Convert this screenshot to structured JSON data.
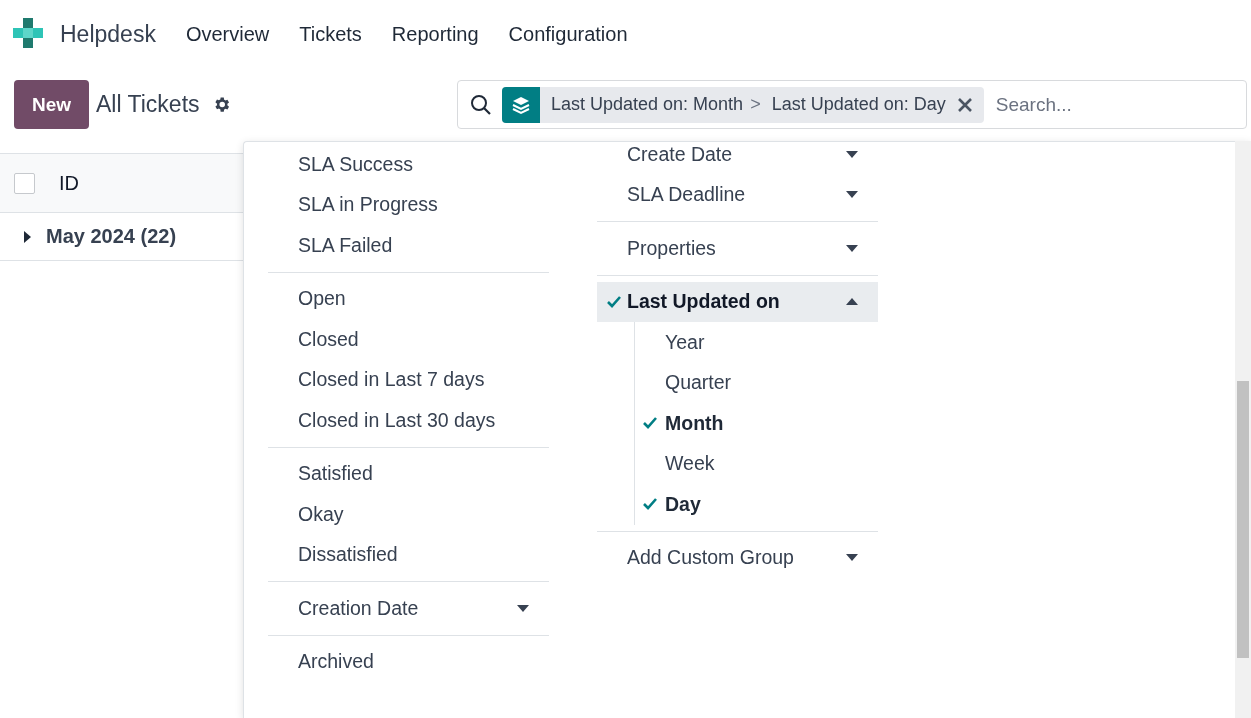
{
  "navbar": {
    "app_name": "Helpdesk",
    "menus": [
      "Overview",
      "Tickets",
      "Reporting",
      "Configuration"
    ]
  },
  "control_panel": {
    "new_button": "New",
    "title": "All Tickets"
  },
  "search": {
    "facet": {
      "values": [
        "Last Updated on: Month",
        "Last Updated on: Day"
      ],
      "separator": ">"
    },
    "placeholder": "Search..."
  },
  "list": {
    "header": {
      "checked": false,
      "label": "ID"
    },
    "groups": [
      {
        "label": "May 2024 (22)",
        "expanded": false
      }
    ]
  },
  "filters": [
    [
      {
        "label": "SLA Success",
        "kind": "option"
      },
      {
        "label": "SLA in Progress",
        "kind": "option"
      },
      {
        "label": "SLA Failed",
        "kind": "option"
      }
    ],
    [
      {
        "label": "Open",
        "kind": "option"
      },
      {
        "label": "Closed",
        "kind": "option"
      },
      {
        "label": "Closed in Last 7 days",
        "kind": "option"
      },
      {
        "label": "Closed in Last 30 days",
        "kind": "option"
      }
    ],
    [
      {
        "label": "Satisfied",
        "kind": "option"
      },
      {
        "label": "Okay",
        "kind": "option"
      },
      {
        "label": "Dissatisfied",
        "kind": "option"
      }
    ],
    [
      {
        "label": "Creation Date",
        "kind": "dropdown",
        "expanded": false
      }
    ],
    [
      {
        "label": "Archived",
        "kind": "option"
      }
    ]
  ],
  "group_by": [
    [
      {
        "label": "Create Date",
        "kind": "dropdown",
        "expanded": false
      },
      {
        "label": "SLA Deadline",
        "kind": "dropdown",
        "expanded": false
      }
    ],
    [
      {
        "label": "Properties",
        "kind": "dropdown",
        "expanded": false
      }
    ],
    [
      {
        "label": "Last Updated on",
        "kind": "dropdown",
        "expanded": true,
        "checked": true,
        "children": [
          {
            "label": "Year",
            "checked": false
          },
          {
            "label": "Quarter",
            "checked": false
          },
          {
            "label": "Month",
            "checked": true
          },
          {
            "label": "Week",
            "checked": false
          },
          {
            "label": "Day",
            "checked": true
          }
        ]
      }
    ],
    [
      {
        "label": "Add Custom Group",
        "kind": "dropdown",
        "expanded": false
      }
    ]
  ]
}
